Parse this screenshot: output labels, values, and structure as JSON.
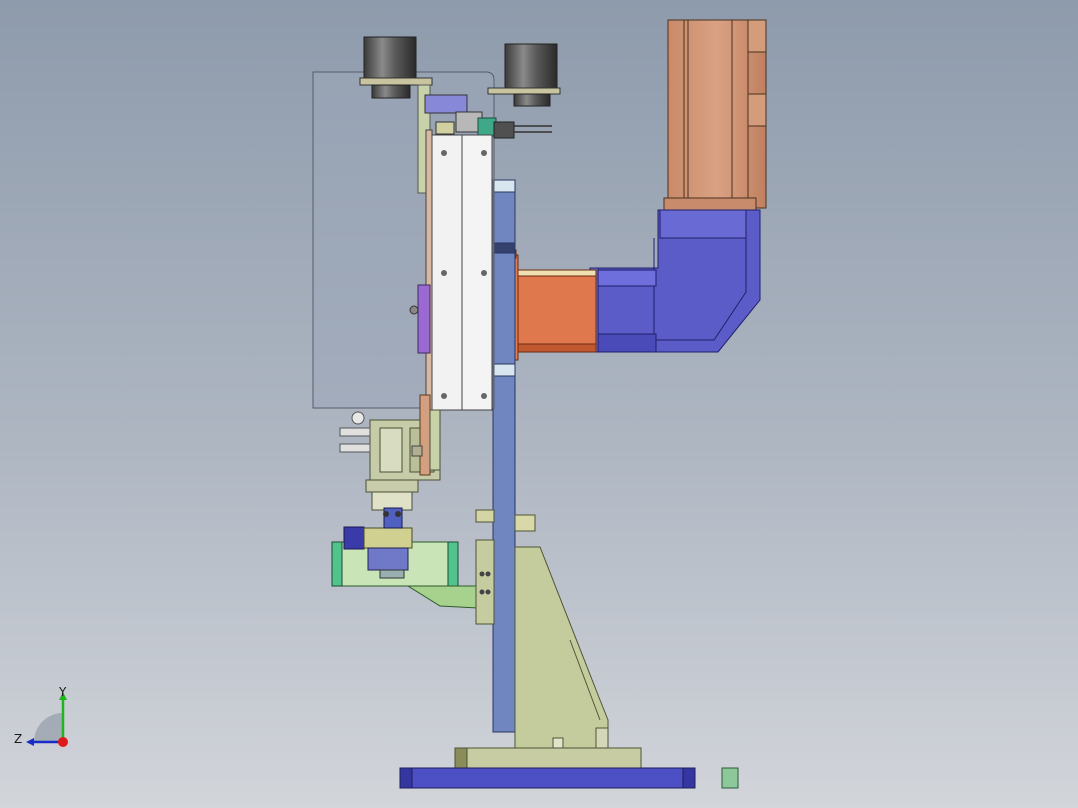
{
  "viewport": {
    "background_top": "#8e9bac",
    "background_bottom": "#d2d5da",
    "model": {
      "parts": [
        "servo-motor",
        "right-angle-gearbox",
        "coupling-block",
        "vertical-column",
        "support-gusset",
        "base-plate",
        "cylinder-top-left",
        "cylinder-top-right",
        "transparent-guard-cover",
        "slide-plate",
        "pneumatic-actuator",
        "gripper-assembly"
      ]
    }
  },
  "triad": {
    "y_label": "Y",
    "z_label": "Z",
    "colors": {
      "y": "#1fb51f",
      "z": "#1a2cc8",
      "origin": "#e01818"
    }
  }
}
